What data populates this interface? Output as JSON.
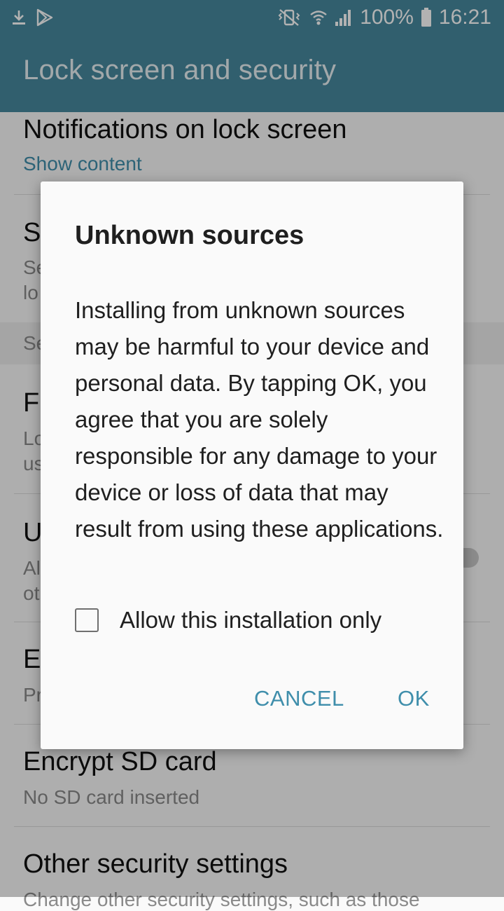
{
  "status_bar": {
    "icons_left": [
      "download-icon",
      "play-store-icon"
    ],
    "icons_right": [
      "vibrate-icon",
      "wifi-icon",
      "signal-icon",
      "battery-icon"
    ],
    "battery_text": "100%",
    "time": "16:21"
  },
  "header": {
    "title": "Lock screen and security"
  },
  "settings": {
    "items": [
      {
        "title": "Notifications on lock screen",
        "subtitle": "Show content"
      },
      {
        "title": "S",
        "subtitle_lines": [
          "Se",
          "lo"
        ]
      },
      {
        "section": "Se"
      },
      {
        "title": "F",
        "subtitle_lines": [
          "Lo",
          "us"
        ]
      },
      {
        "title": "U",
        "subtitle_lines": [
          "Al",
          "ot"
        ]
      },
      {
        "title": "E",
        "subtitle": "Pr"
      },
      {
        "title": "Encrypt SD card",
        "subtitle": "No SD card inserted"
      },
      {
        "title": "Other security settings",
        "subtitle": "Change other security settings, such as those"
      }
    ]
  },
  "dialog": {
    "title": "Unknown sources",
    "message": "Installing from unknown sources may be harmful to your device and personal data. By tapping OK, you agree that you are solely responsible for any damage to your device or loss of data that may result from using these applications.",
    "checkbox_label": "Allow this installation only",
    "checkbox_checked": false,
    "cancel_label": "CANCEL",
    "ok_label": "OK"
  },
  "colors": {
    "primary": "#47899e",
    "accent": "#3f8eab"
  }
}
